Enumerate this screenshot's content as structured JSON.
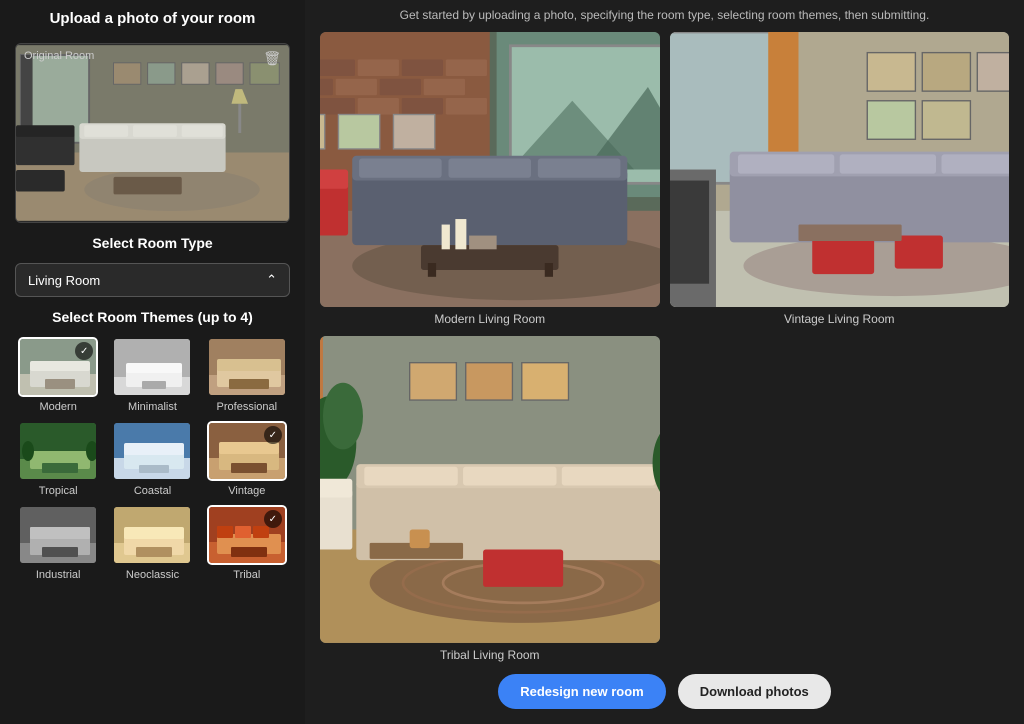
{
  "left": {
    "upload_title": "Upload a photo of your room",
    "upload_label": "Original Room",
    "delete_icon": "🗑",
    "room_type_title": "Select Room Type",
    "room_type_value": "Living Room",
    "chevron_icon": "⌃",
    "themes_title": "Select Room Themes (up to 4)",
    "themes": [
      {
        "id": "modern",
        "label": "Modern",
        "selected": true,
        "css_class": "t-modern"
      },
      {
        "id": "minimalist",
        "label": "Minimalist",
        "selected": false,
        "css_class": "t-minimalist"
      },
      {
        "id": "professional",
        "label": "Professional",
        "selected": false,
        "css_class": "t-professional"
      },
      {
        "id": "tropical",
        "label": "Tropical",
        "selected": false,
        "css_class": "t-tropical"
      },
      {
        "id": "coastal",
        "label": "Coastal",
        "selected": false,
        "css_class": "t-coastal"
      },
      {
        "id": "vintage",
        "label": "Vintage",
        "selected": true,
        "css_class": "t-vintage"
      },
      {
        "id": "industrial",
        "label": "Industrial",
        "selected": false,
        "css_class": "t-industrial"
      },
      {
        "id": "neoclassic",
        "label": "Neoclassic",
        "selected": false,
        "css_class": "t-neoclassic"
      },
      {
        "id": "tribal",
        "label": "Tribal",
        "selected": true,
        "css_class": "t-tribal"
      }
    ]
  },
  "right": {
    "header_text": "Get started by uploading a photo, specifying the room type, selecting room themes, then submitting.",
    "results": [
      {
        "id": "modern",
        "label": "Modern Living Room"
      },
      {
        "id": "vintage",
        "label": "Vintage Living Room"
      },
      {
        "id": "tribal",
        "label": "Tribal Living Room"
      }
    ],
    "btn_redesign": "Redesign new room",
    "btn_download": "Download photos"
  }
}
